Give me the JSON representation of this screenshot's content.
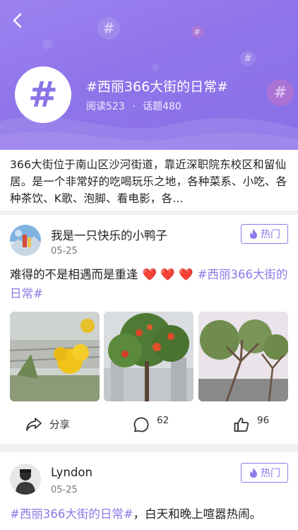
{
  "header": {
    "topic_title": "#西丽366大街的日常#",
    "read_label": "阅读523",
    "dot": "·",
    "topic_count_label": "话题480",
    "hash_symbol": "#",
    "back_icon": "chevron-left-icon",
    "gradient_color": "#8f74e9"
  },
  "description": "366大街位于南山区沙河街道，靠近深职院东校区和留仙居。是一个非常好的吃喝玩乐之地，各种菜系、小吃、各种茶饮、K歌、泡脚、看电影，各…",
  "posts": [
    {
      "username": "我是一只快乐的小鸭子",
      "date": "05-25",
      "hot_label": "热门",
      "text": "难得的不是相遇而是重逢",
      "hearts": "❤️ ❤️ ❤️",
      "tag": "#西丽366大街的日常#",
      "share_label": "分享",
      "comment_count": "62",
      "like_count": "96"
    },
    {
      "username": "Lyndon",
      "date": "05-25",
      "hot_label": "热门",
      "tag": "#西丽366大街的日常#",
      "text": "，白天和晚上喧嚣热闹。"
    }
  ],
  "colors": {
    "accent": "#8b78e6",
    "heart": "#e0202a"
  }
}
